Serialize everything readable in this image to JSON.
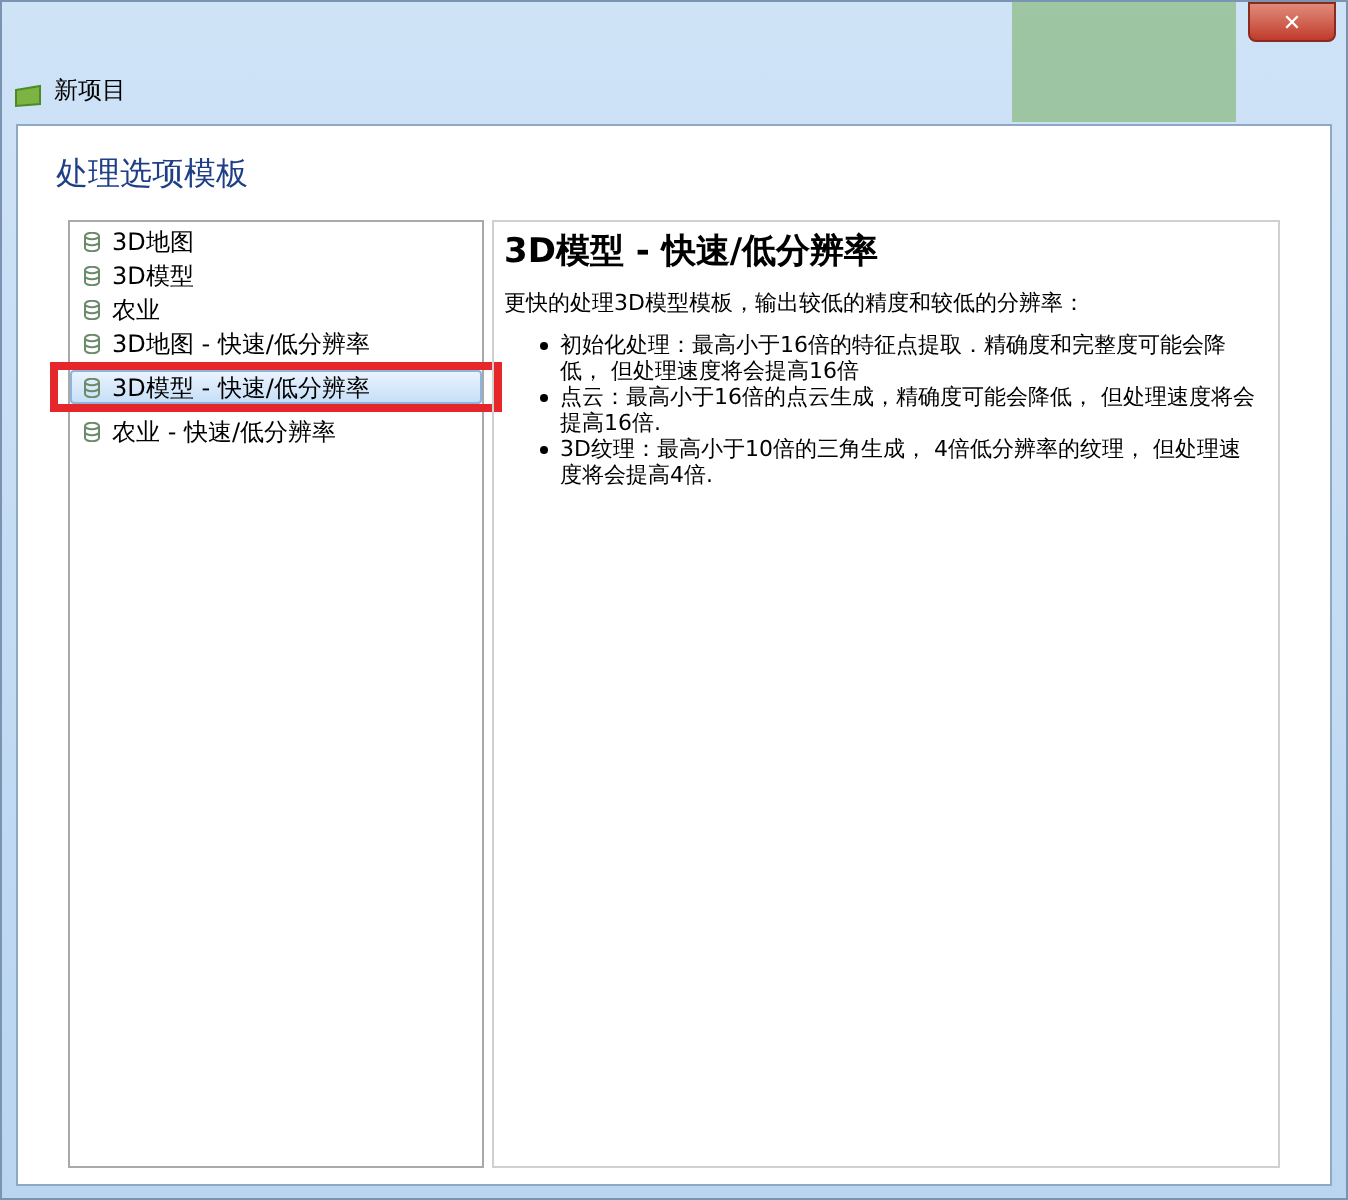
{
  "window": {
    "title": "新项目",
    "close": "✕"
  },
  "heading": "处理选项模板",
  "templates": [
    {
      "label": "3D地图",
      "selected": false,
      "highlighted": false
    },
    {
      "label": "3D模型",
      "selected": false,
      "highlighted": false
    },
    {
      "label": "农业",
      "selected": false,
      "highlighted": false
    },
    {
      "label": "3D地图 - 快速/低分辨率",
      "selected": false,
      "highlighted": false
    },
    {
      "label": "3D模型 - 快速/低分辨率",
      "selected": true,
      "highlighted": true
    },
    {
      "label": "农业 - 快速/低分辨率",
      "selected": false,
      "highlighted": false
    }
  ],
  "description": {
    "title": "3D模型 - 快速/低分辨率",
    "intro": "更快的处理3D模型模板，输出较低的精度和较低的分辨率：",
    "bullets": [
      "初始化处理：最高小于16倍的特征点提取．精确度和完整度可能会降低， 但处理速度将会提高16倍",
      "点云：最高小于16倍的点云生成，精确度可能会降低， 但处理速度将会提高16倍.",
      "3D纹理：最高小于10倍的三角生成， 4倍低分辨率的纹理， 但处理速度将会提高4倍."
    ]
  }
}
